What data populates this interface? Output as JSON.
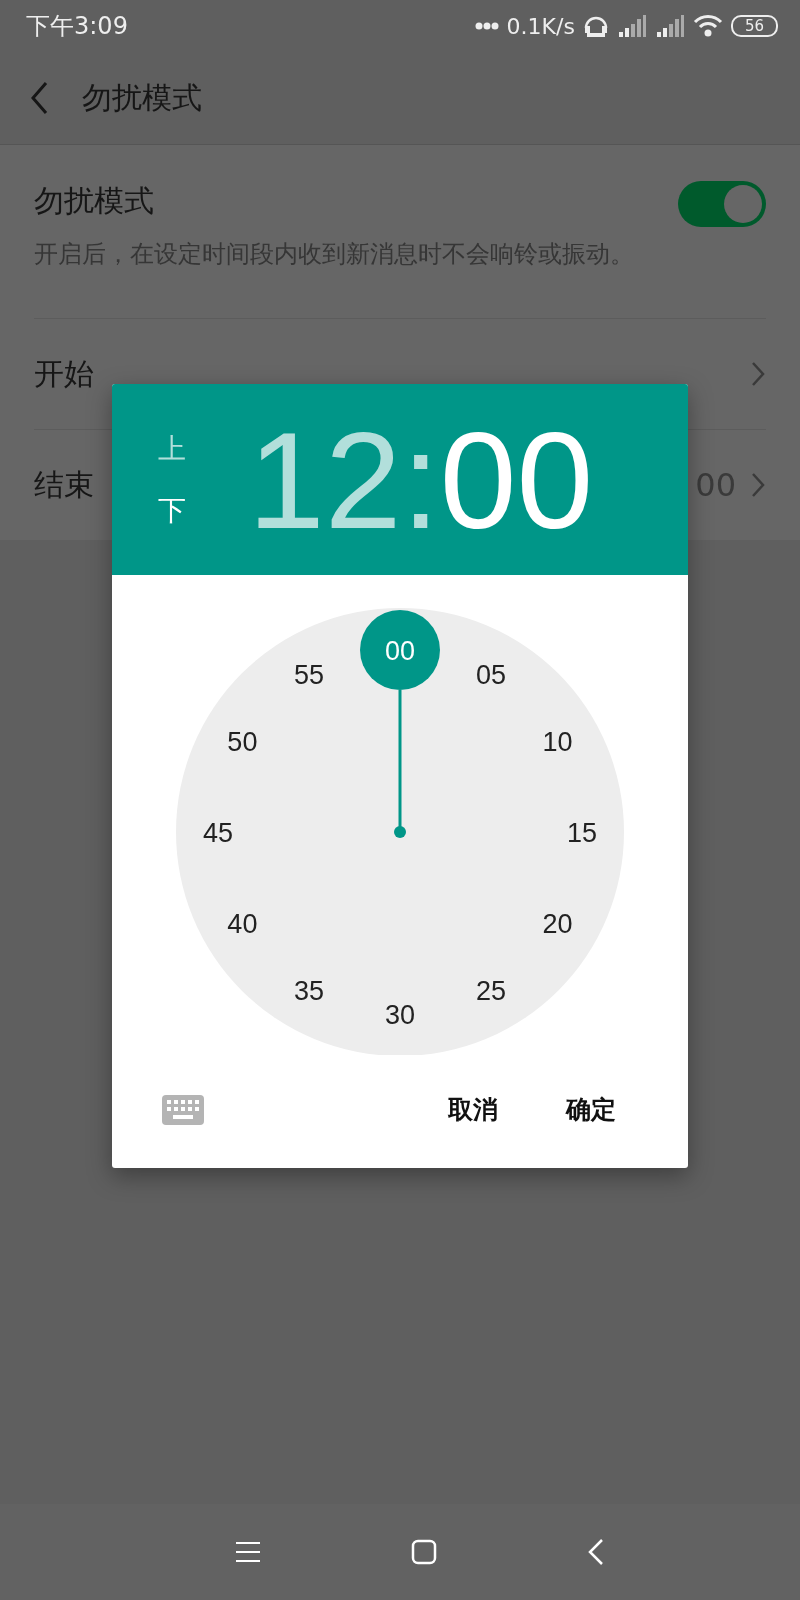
{
  "status_bar": {
    "time": "下午3:09",
    "network_speed": "0.1K/s",
    "battery": "56"
  },
  "header": {
    "title": "勿扰模式"
  },
  "settings": {
    "toggle": {
      "label": "勿扰模式",
      "description": "开启后，在设定时间段内收到新消息时不会响铃或振动。",
      "on": true
    },
    "rows": [
      {
        "label": "开始"
      },
      {
        "label": "结束",
        "value": "00"
      }
    ]
  },
  "dialog": {
    "ampm": [
      {
        "label": "上",
        "selected": false
      },
      {
        "label": "下",
        "selected": true
      }
    ],
    "time_parts": [
      {
        "text": "12",
        "selected": false
      },
      {
        "text": ":",
        "selected": false
      },
      {
        "text": "00",
        "selected": true
      }
    ],
    "marks": [
      {
        "label": "00",
        "selected": true
      },
      {
        "label": "05",
        "selected": false
      },
      {
        "label": "10",
        "selected": false
      },
      {
        "label": "15",
        "selected": false
      },
      {
        "label": "20",
        "selected": false
      },
      {
        "label": "25",
        "selected": false
      },
      {
        "label": "30",
        "selected": false
      },
      {
        "label": "35",
        "selected": false
      },
      {
        "label": "40",
        "selected": false
      },
      {
        "label": "45",
        "selected": false
      },
      {
        "label": "50",
        "selected": false
      },
      {
        "label": "55",
        "selected": false
      }
    ],
    "buttons": [
      "取消",
      "确定"
    ]
  }
}
